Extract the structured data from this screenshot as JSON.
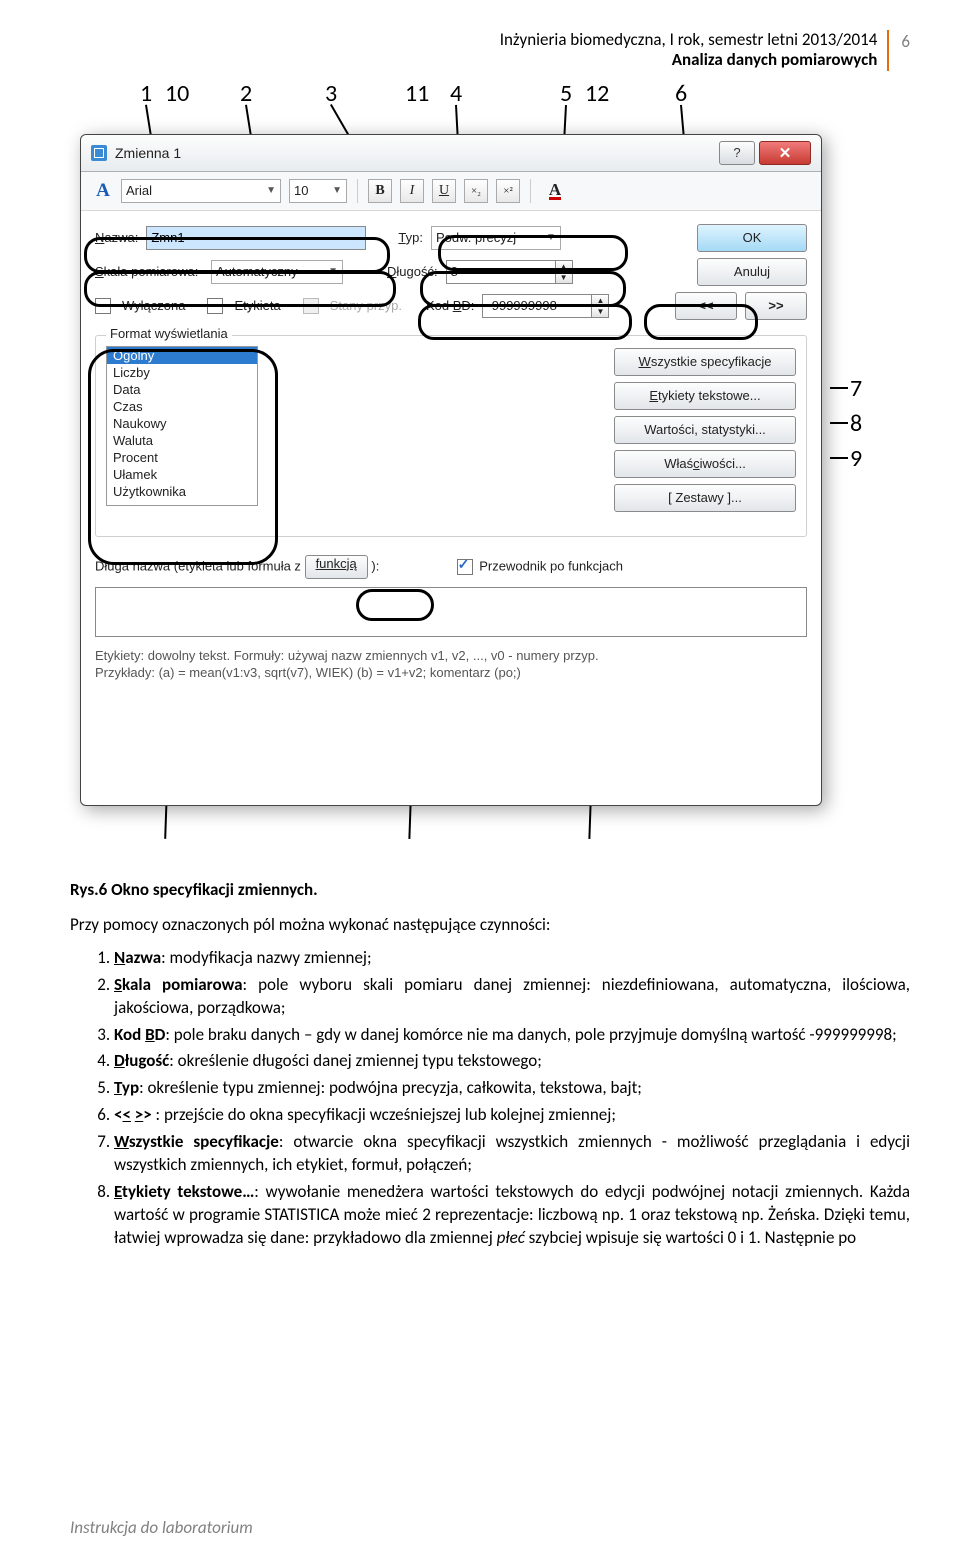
{
  "header": {
    "line1": "Inżynieria biomedyczna, I rok, semestr letni 2013/2014",
    "line2": "Analiza danych pomiarowych",
    "pagenum": "6"
  },
  "annotations": {
    "top": [
      "1",
      "2",
      "3",
      "4",
      "5",
      "6"
    ],
    "right": [
      "7",
      "8",
      "9"
    ],
    "bottom": [
      "10",
      "11",
      "12"
    ]
  },
  "dialog": {
    "title": "Zmienna 1",
    "font": "Arial",
    "size": "10",
    "name_label": "Nazwa:",
    "name_value": "Zmn1",
    "typ_label": "Typ:",
    "typ_value": "Podw. precyzj",
    "ok": "OK",
    "cancel": "Anuluj",
    "scale_label": "Skala pomiarowa:",
    "scale_value": "Automatyczny",
    "length_label": "Długość:",
    "length_value": "8",
    "chk_off": "Wyłączona",
    "chk_label": "Etykieta",
    "chk_cond": "Stany przyp.",
    "md_label": "Kod BD:",
    "md_value": "-999999998",
    "prev": "<<",
    "next": ">>",
    "group_title": "Format wyświetlania",
    "formats": [
      "Ogólny",
      "Liczby",
      "Data",
      "Czas",
      "Naukowy",
      "Waluta",
      "Procent",
      "Ułamek",
      "Użytkownika"
    ],
    "btn_all": "Wszystkie specyfikacje",
    "btn_text": "Etykiety tekstowe...",
    "btn_stats": "Wartości, statystyki...",
    "btn_prop": "Właściwości...",
    "btn_sets": "[ Zestawy ]...",
    "ll1": "Długa nazwa (etykieta lub formuła z",
    "ll_btn": "funkcją",
    "ll2": "):",
    "guide": "Przewodnik po funkcjach",
    "hint1": "Etykiety: dowolny tekst. Formuły: używaj nazw zmiennych v1, v2, ..., v0 - numery przyp.",
    "hint2": "Przykłady:   (a) = mean(v1:v3, sqrt(v7), WIEK)   (b) = v1+v2; komentarz (po;)"
  },
  "caption": "Rys.6 Okno specyfikacji zmiennych.",
  "intro": "Przy pomocy oznaczonych pól można wykonać następujące czynności:",
  "items": [
    "<b><u>N</u>azwa</b>: modyfikacja nazwy zmiennej;",
    "<b><u>S</u>kala pomiarowa</b>: pole wyboru skali pomiaru danej zmiennej: niezdefiniowana, automatyczna, ilościowa, jakościowa, porządkowa;",
    "<b>Kod <u>B</u>D</b>: pole braku danych – gdy w danej komórce nie ma danych, pole przyjmuje domyślną wartość -999999998;",
    "<b><u>D</u>ługość</b>: określenie długości danej zmiennej typu tekstowego;",
    "<b><u>T</u>yp</b>: określenie typu zmiennej: podwójna precyzja, całkowita, tekstowa, bajt;",
    "<b>&lt;<u>&lt;</u> <u>&gt;</u>&gt;</b> : przejście do okna specyfikacji wcześniejszej lub kolejnej zmiennej;",
    "<b><u>W</u>szystkie specyfikacje</b>: otwarcie okna specyfikacji wszystkich zmiennych - możliwość przeglądania i edycji wszystkich zmiennych, ich etykiet, formuł, połączeń;",
    "<b><u>E</u>tykiety tekstowe…</b>: wywołanie menedżera wartości tekstowych do edycji podwójnej notacji zmiennych. Każda wartość w programie STATISTICA może mieć 2 reprezentacje: liczbową np. 1 oraz tekstową np. Żeńska. Dzięki temu, łatwiej wprowadza się dane: przykładowo dla zmiennej <i>płeć</i> szybciej wpisuje się wartości 0 i 1. Następnie po"
  ],
  "footer": "Instrukcja do laboratorium"
}
